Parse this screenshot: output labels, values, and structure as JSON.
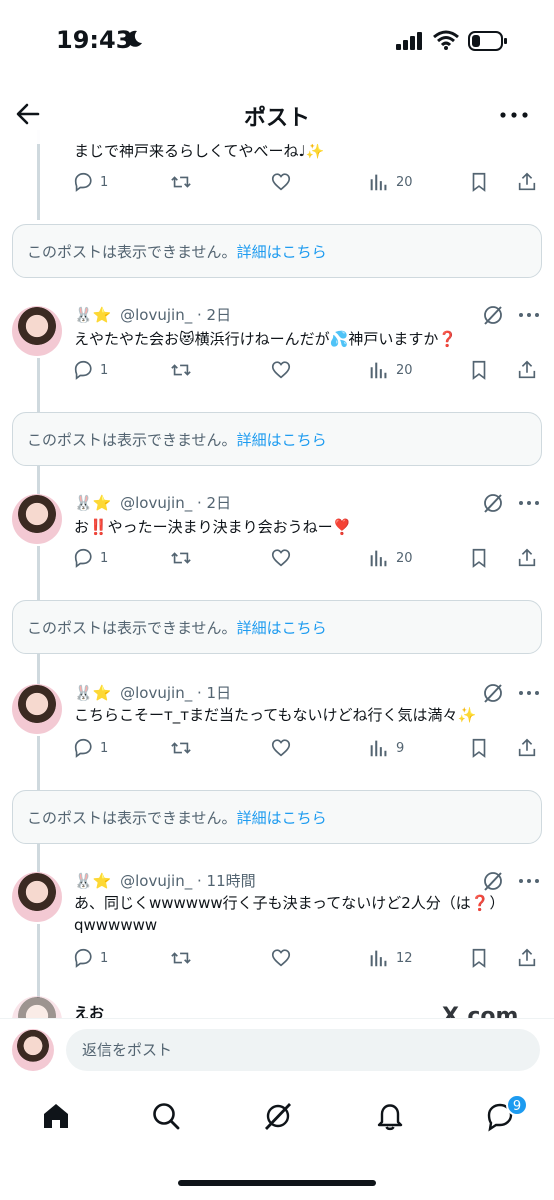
{
  "status": {
    "time": "19:43"
  },
  "header": {
    "title": "ポスト"
  },
  "partial_post": {
    "text": "まじで神戸来るらしくてやべーね♩✨",
    "stats": {
      "reply": "1",
      "views": "20"
    }
  },
  "unavailable": {
    "text": "このポストは表示できません。",
    "link": "詳細はこちら"
  },
  "posts": [
    {
      "emoji": "🐰⭐",
      "handle": "@lovujin_",
      "time": "2日",
      "text": "えやたやた会お😻横浜行けねーんだが💦神戸いますか❓",
      "reply": "1",
      "views": "20"
    },
    {
      "emoji": "🐰⭐",
      "handle": "@lovujin_",
      "time": "2日",
      "text": "お‼️やったー決まり決まり会おうねー❣️",
      "reply": "1",
      "views": "20"
    },
    {
      "emoji": "🐰⭐",
      "handle": "@lovujin_",
      "time": "1日",
      "text": "こちらこそーᴛ_ᴛまだ当たってもないけどね行く気は満々✨",
      "reply": "1",
      "views": "9"
    },
    {
      "emoji": "🐰⭐",
      "handle": "@lovujin_",
      "time": "11時間",
      "text": "あ、同じくwwwwww行く子も決まってないけど2人分（は❓）qwwwwww",
      "reply": "1",
      "views": "12"
    }
  ],
  "cutoff_post": {
    "name": "えお"
  },
  "watermark": "X.com",
  "reply_bar": {
    "placeholder": "返信をポスト"
  },
  "tabbar": {
    "badge": "9"
  },
  "colors": {
    "accent": "#1d9bf0",
    "text": "#0f1419",
    "muted": "#536471",
    "border": "#cfd9de"
  }
}
